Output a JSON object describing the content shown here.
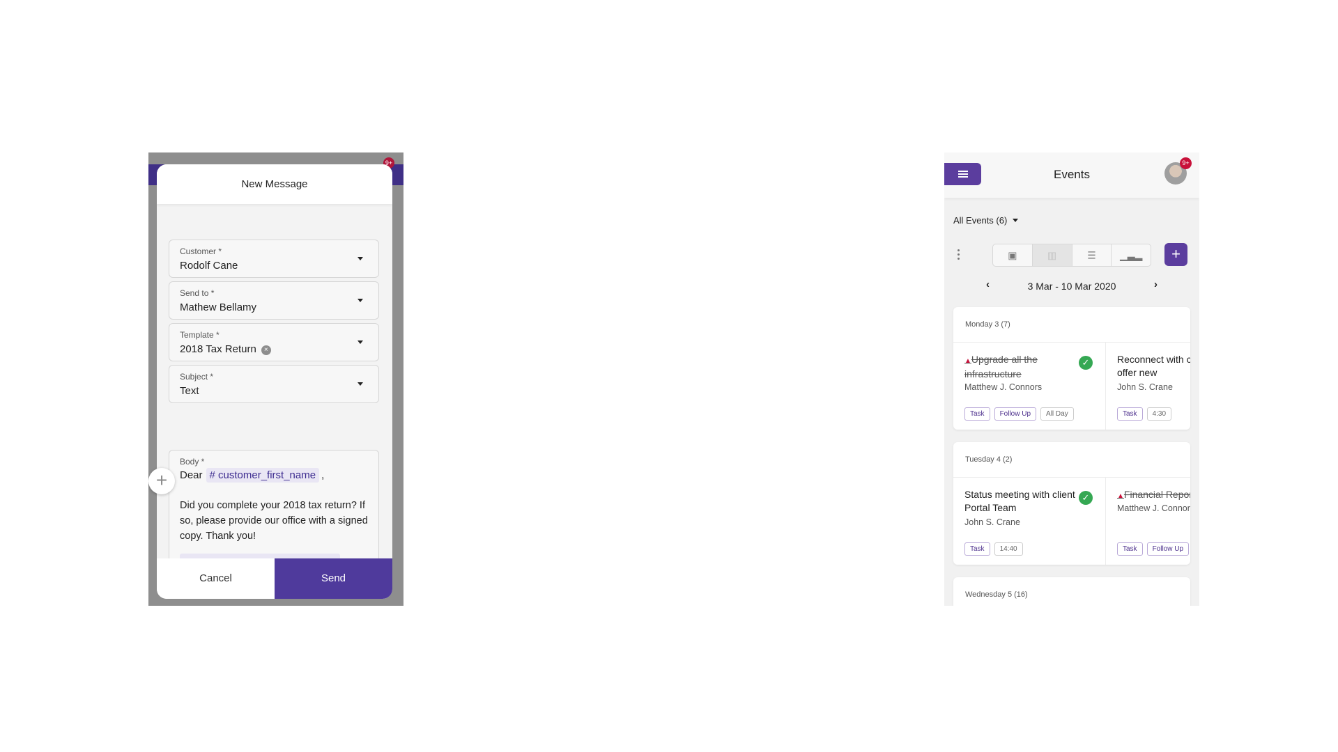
{
  "new_message": {
    "title": "New Message",
    "badge": "9+",
    "fields": {
      "customer": {
        "label": "Customer *",
        "value": "Rodolf Cane"
      },
      "send_to": {
        "label": "Send to *",
        "value": "Mathew Bellamy"
      },
      "template": {
        "label": "Template *",
        "value": "2018 Tax Return"
      },
      "subject": {
        "label": "Subject *",
        "value": "Text"
      },
      "body": {
        "label": "Body *",
        "greeting": "Dear",
        "tag": "# customer_first_name",
        "comma": ",",
        "text": "Did you complete your 2018 tax return? If so, please provide our office with a signed copy. Thank you!"
      }
    },
    "clear_glyph": "×",
    "add_glyph": "+",
    "cancel_label": "Cancel",
    "send_label": "Send"
  },
  "events": {
    "title": "Events",
    "notif_count": "9+",
    "filter_label": "All Events (6)",
    "add_glyph": "+",
    "date_range": "3 Mar - 10 Mar 2020",
    "prev_glyph": "‹",
    "next_glyph": "›",
    "view_icons": [
      "calendar-icon",
      "columns-icon",
      "list-icon",
      "chart-icon"
    ],
    "days": [
      {
        "header": "Monday 3  (7)",
        "events": [
          {
            "alert": "▲",
            "title": "Upgrade all the infrastructure",
            "person": "Matthew J. Connors",
            "chips": [
              "Task",
              "Follow Up",
              "All Day"
            ],
            "done": true
          },
          {
            "alert": "",
            "title": "Reconnect with client to offer new",
            "person": "John S. Crane",
            "chips": [
              "Task",
              "4:30"
            ],
            "done": false
          }
        ]
      },
      {
        "header": "Tuesday 4  (2)",
        "events": [
          {
            "alert": "",
            "title": "Status meeting with client Portal Team",
            "person": "John S. Crane",
            "chips": [
              "Task",
              "14:40"
            ],
            "done": true
          },
          {
            "alert": "▲",
            "title": "Financial Report",
            "person": "Matthew J. Connors",
            "chips": [
              "Task",
              "Follow Up"
            ],
            "done": false
          }
        ]
      },
      {
        "header": "Wednesday 5  (16)",
        "events": []
      }
    ],
    "accent_color": "#5b3d9e",
    "success_color": "#35a853",
    "alert_color": "#c8113a"
  }
}
